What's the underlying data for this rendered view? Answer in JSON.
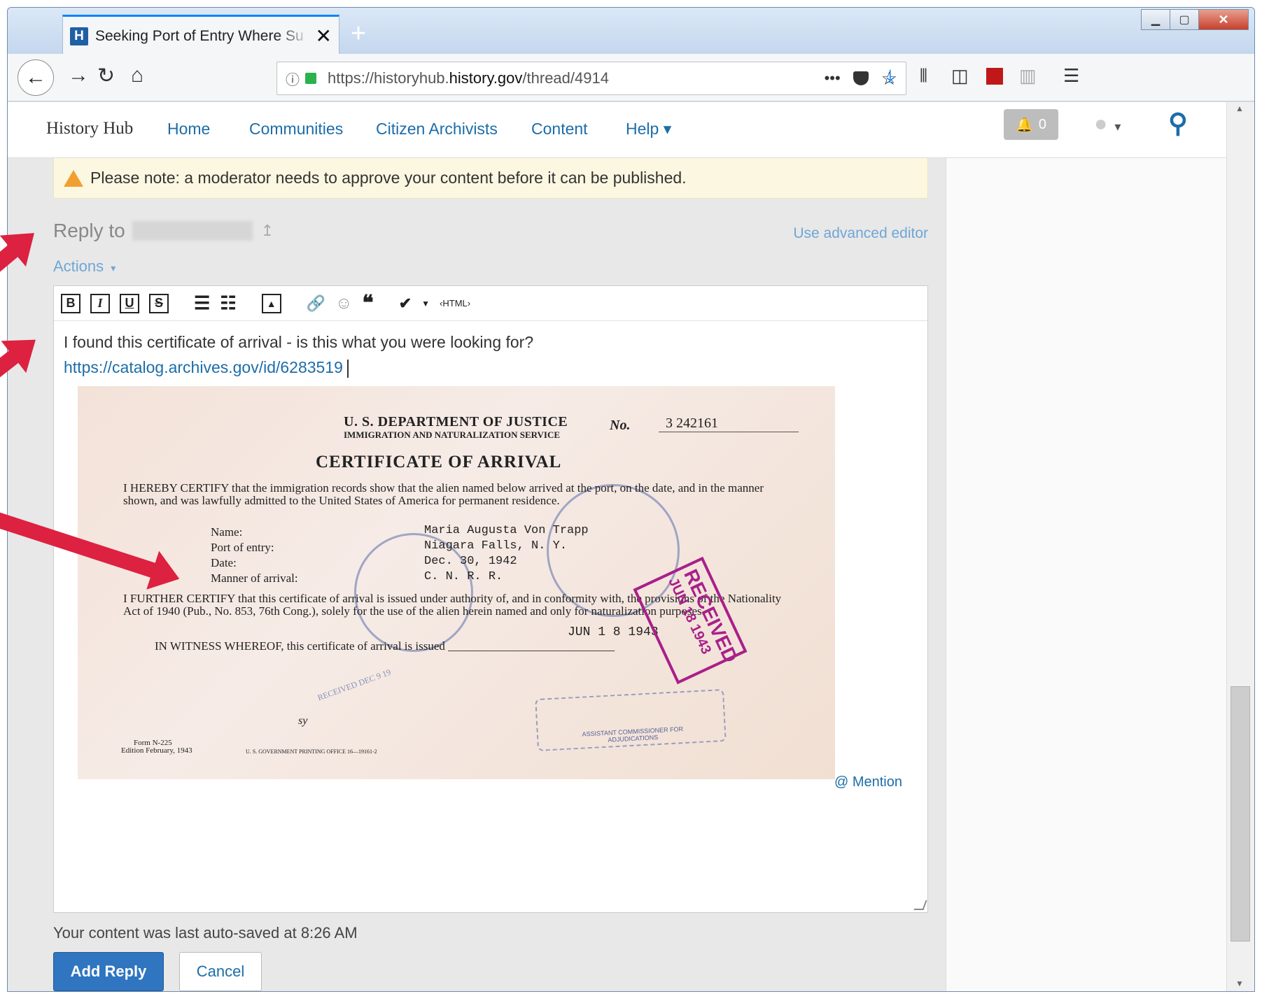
{
  "browser": {
    "tab_title": "Seeking Port of Entry Where Su",
    "tab_favicon_letter": "H",
    "new_tab": "+",
    "url_prefix": "https://historyhub.",
    "url_domain": "history.gov",
    "url_path": "/thread/4914",
    "page_actions": "•••"
  },
  "site": {
    "brand": "History Hub",
    "nav": [
      "Home",
      "Communities",
      "Citizen Archivists",
      "Content",
      "Help ▾"
    ],
    "notifications_count": "0"
  },
  "reply": {
    "notice": "Please note: a moderator needs to approve your content before it can be published.",
    "reply_to_label": "Reply to",
    "advanced_editor": "Use advanced editor",
    "actions": "Actions",
    "body_line1": "I found this certificate of arrival - is this what you were looking for?",
    "body_link": "https://catalog.archives.gov/id/6283519",
    "mention": "@ Mention",
    "autosave": "Your content was last auto-saved at 8:26 AM",
    "add_reply": "Add Reply",
    "cancel": "Cancel"
  },
  "toolbar": {
    "bold": "B",
    "italic": "I",
    "underline": "U",
    "strike": "S",
    "html": "‹HTML›"
  },
  "certificate": {
    "dept": "U. S. DEPARTMENT OF JUSTICE",
    "service": "IMMIGRATION AND NATURALIZATION SERVICE",
    "no_label": "No.",
    "no_value": "3   242161",
    "title": "CERTIFICATE OF ARRIVAL",
    "para1": "I HEREBY CERTIFY that the immigration records show that the alien named below arrived at the port, on the date, and in the manner shown, and was lawfully admitted to the United States of America for permanent residence.",
    "field_labels": [
      "Name:",
      "Port of entry:",
      "Date:",
      "Manner of arrival:"
    ],
    "field_values": [
      "Maria Augusta Von Trapp",
      "Niagara Falls, N. Y.",
      "Dec. 30, 1942",
      "C. N. R. R."
    ],
    "para2": "I FURTHER CERTIFY that this certificate of arrival is issued under authority of, and in conformity with, the provisions of the Nationality Act of 1940 (Pub., No. 853, 76th Cong.), solely for the use of the alien herein named and only for naturalization purposes.",
    "witness": "IN WITNESS WHEREOF, this certificate of arrival is issued",
    "issue_date": "JUN 1 8 1943",
    "form": "Form N-225",
    "edition": "Edition February, 1943",
    "gpo": "U. S. GOVERNMENT PRINTING OFFICE    16—19161-2",
    "stamp_received": "RECEIVED",
    "stamp_received_date": "JUN 18 1943",
    "stamp_circle": "RECEIVED DEC 9 19",
    "sig_caption": "ASSISTANT COMMISSIONER FOR ADJUDICATIONS",
    "initials": "sy"
  }
}
